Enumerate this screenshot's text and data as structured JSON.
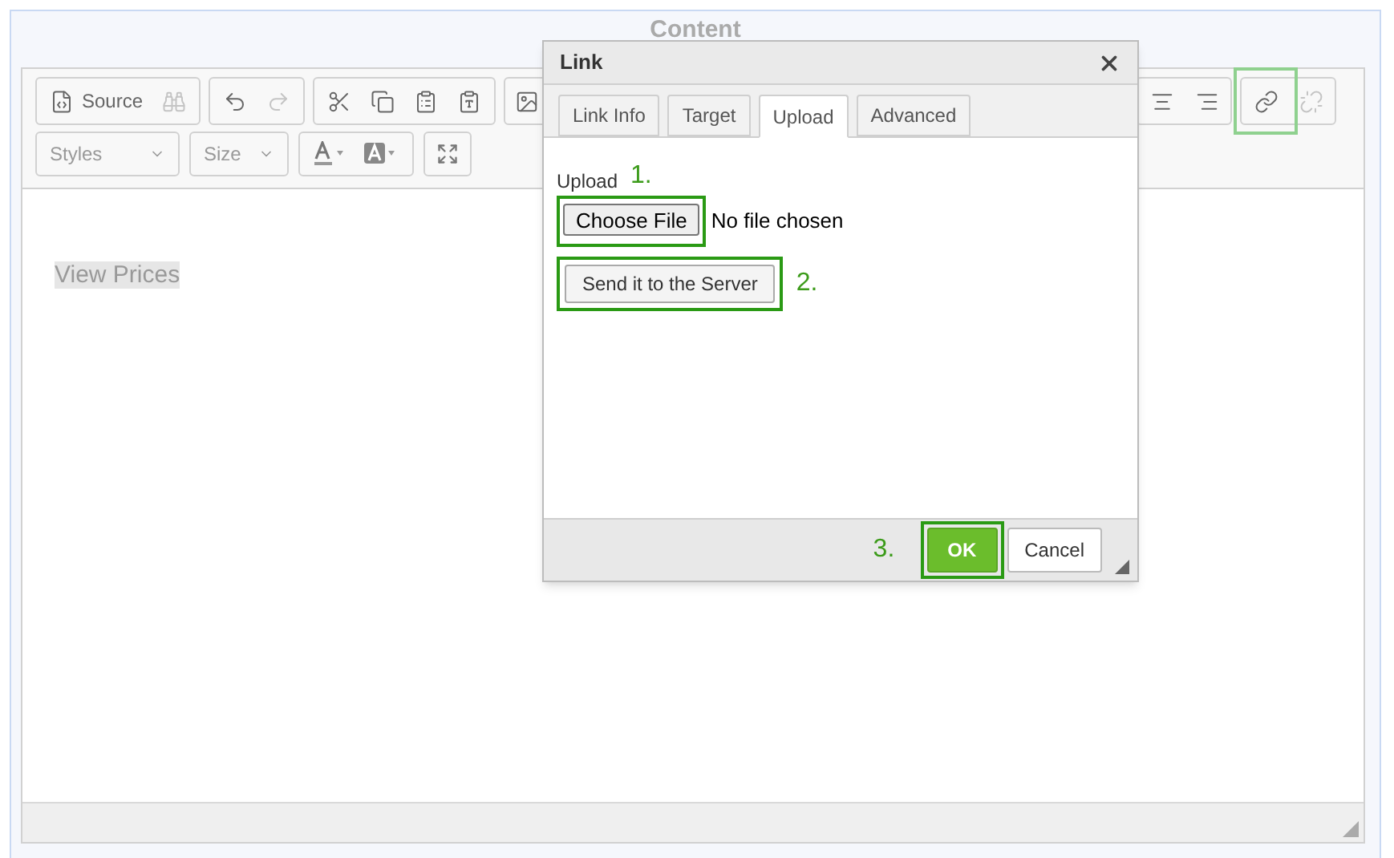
{
  "editor": {
    "heading": "Content",
    "toolbar_row_1": [
      {
        "items": [
          {
            "label": "Source",
            "disabled": false,
            "highlighted": false
          },
          {
            "disabled": true,
            "highlighted": false
          }
        ]
      },
      {
        "items": [
          {
            "disabled": false,
            "highlighted": false
          },
          {
            "disabled": true,
            "highlighted": false
          }
        ]
      },
      {
        "items": [
          {
            "disabled": false,
            "highlighted": false
          },
          {
            "disabled": false,
            "highlighted": false
          },
          {
            "disabled": false,
            "highlighted": false
          },
          {
            "disabled": false,
            "highlighted": false
          }
        ]
      }
    ],
    "toolbar_row_1_right": [
      {
        "items": [
          {
            "disabled": false,
            "highlighted": false
          },
          {
            "disabled": false,
            "highlighted": false
          }
        ]
      },
      {
        "items": [
          {
            "disabled": false,
            "highlighted": true
          },
          {
            "disabled": true,
            "highlighted": false
          }
        ]
      }
    ],
    "toolbar_row_2": [
      {
        "kind": "dropdown",
        "label": "Styles"
      },
      {
        "kind": "dropdown",
        "label": "Size"
      },
      {
        "kind": "colors"
      },
      {
        "kind": "maximize"
      }
    ],
    "content": {
      "text": "View Prices",
      "selected": true
    }
  },
  "dialog": {
    "title": "Link",
    "tabs": [
      {
        "label": "Link Info",
        "selected": false
      },
      {
        "label": "Target",
        "selected": false
      },
      {
        "label": "Upload",
        "selected": true
      },
      {
        "label": "Advanced",
        "selected": false
      }
    ],
    "upload_label": "Upload",
    "step_1": "1.",
    "choose_file": "Choose File",
    "file_status": "No file chosen",
    "send_button": "Send it to the Server",
    "step_2": "2.",
    "step_3": "3.",
    "buttons": [
      {
        "label": "OK",
        "kind": "primary"
      },
      {
        "label": "Cancel",
        "kind": "secondary"
      }
    ]
  }
}
